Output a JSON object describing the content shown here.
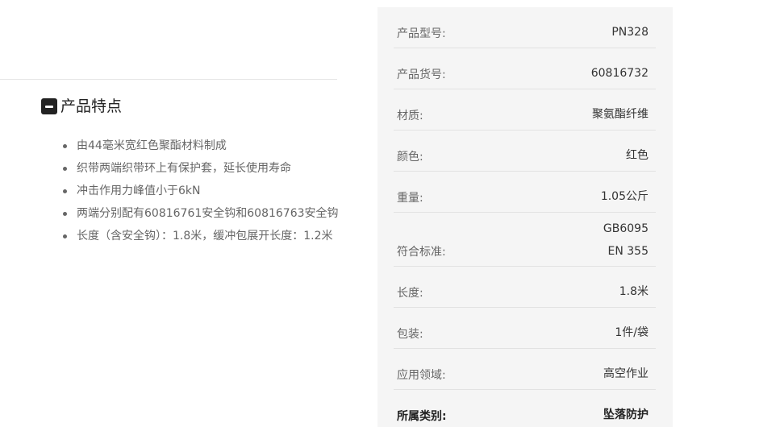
{
  "features": {
    "title": "产品特点",
    "items": [
      "由44毫米宽红色聚酯材料制成",
      "织带两端织带环上有保护套，延长使用寿命",
      "冲击作用力峰值小于6kN",
      "两端分别配有60816761安全钩和60816763安全钩",
      "长度（含安全钩）：1.8米，缓冲包展开长度：1.2米"
    ]
  },
  "specs": {
    "rows": [
      {
        "label": "产品型号:",
        "values": [
          "PN328"
        ]
      },
      {
        "label": "产品货号:",
        "values": [
          "60816732"
        ]
      },
      {
        "label": "材质:",
        "values": [
          "聚氨酯纤维"
        ]
      },
      {
        "label": "颜色:",
        "values": [
          "红色"
        ]
      },
      {
        "label": "重量:",
        "values": [
          "1.05公斤"
        ]
      },
      {
        "label": "符合标准:",
        "values": [
          "GB6095",
          "EN 355"
        ]
      },
      {
        "label": "长度:",
        "values": [
          "1.8米"
        ]
      },
      {
        "label": "包装:",
        "values": [
          "1件/袋"
        ]
      },
      {
        "label": "应用领域:",
        "values": [
          "高空作业"
        ]
      },
      {
        "label": "所属类别:",
        "values": [
          "坠落防护"
        ]
      }
    ]
  }
}
